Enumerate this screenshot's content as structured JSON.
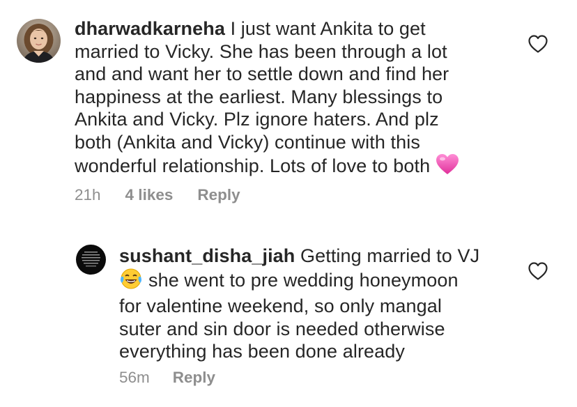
{
  "comments": [
    {
      "username": "dharwadkarneha",
      "lines": [
        "I just want Ankita to get",
        "married to Vicky. She has been through a lot",
        "and and want her to settle down and find her",
        "happiness at the earliest. Many blessings to",
        "Ankita and Vicky. Plz ignore haters. And plz",
        "both (Ankita and Vicky) continue with this",
        "wonderful relationship. Lots of love to both"
      ],
      "trailing_emoji": "pink-heart-emoji",
      "time": "21h",
      "likes": "4 likes",
      "reply_label": "Reply",
      "avatar_icon": "user-avatar",
      "like_icon": "heart-outline-icon"
    },
    {
      "username": "sushant_disha_jiah",
      "lines": [
        "Getting married to VJ",
        "she went to pre wedding honeymoon",
        "for valentine weekend, so only mangal",
        "suter and sin door is needed otherwise",
        "everything has been done already"
      ],
      "leading_emoji": "laughing-tears-emoji",
      "time": "56m",
      "reply_label": "Reply",
      "avatar_icon": "text-avatar",
      "like_icon": "heart-outline-icon"
    }
  ],
  "colors": {
    "text": "#262626",
    "meta": "#8e8e8e",
    "background": "#ffffff"
  }
}
